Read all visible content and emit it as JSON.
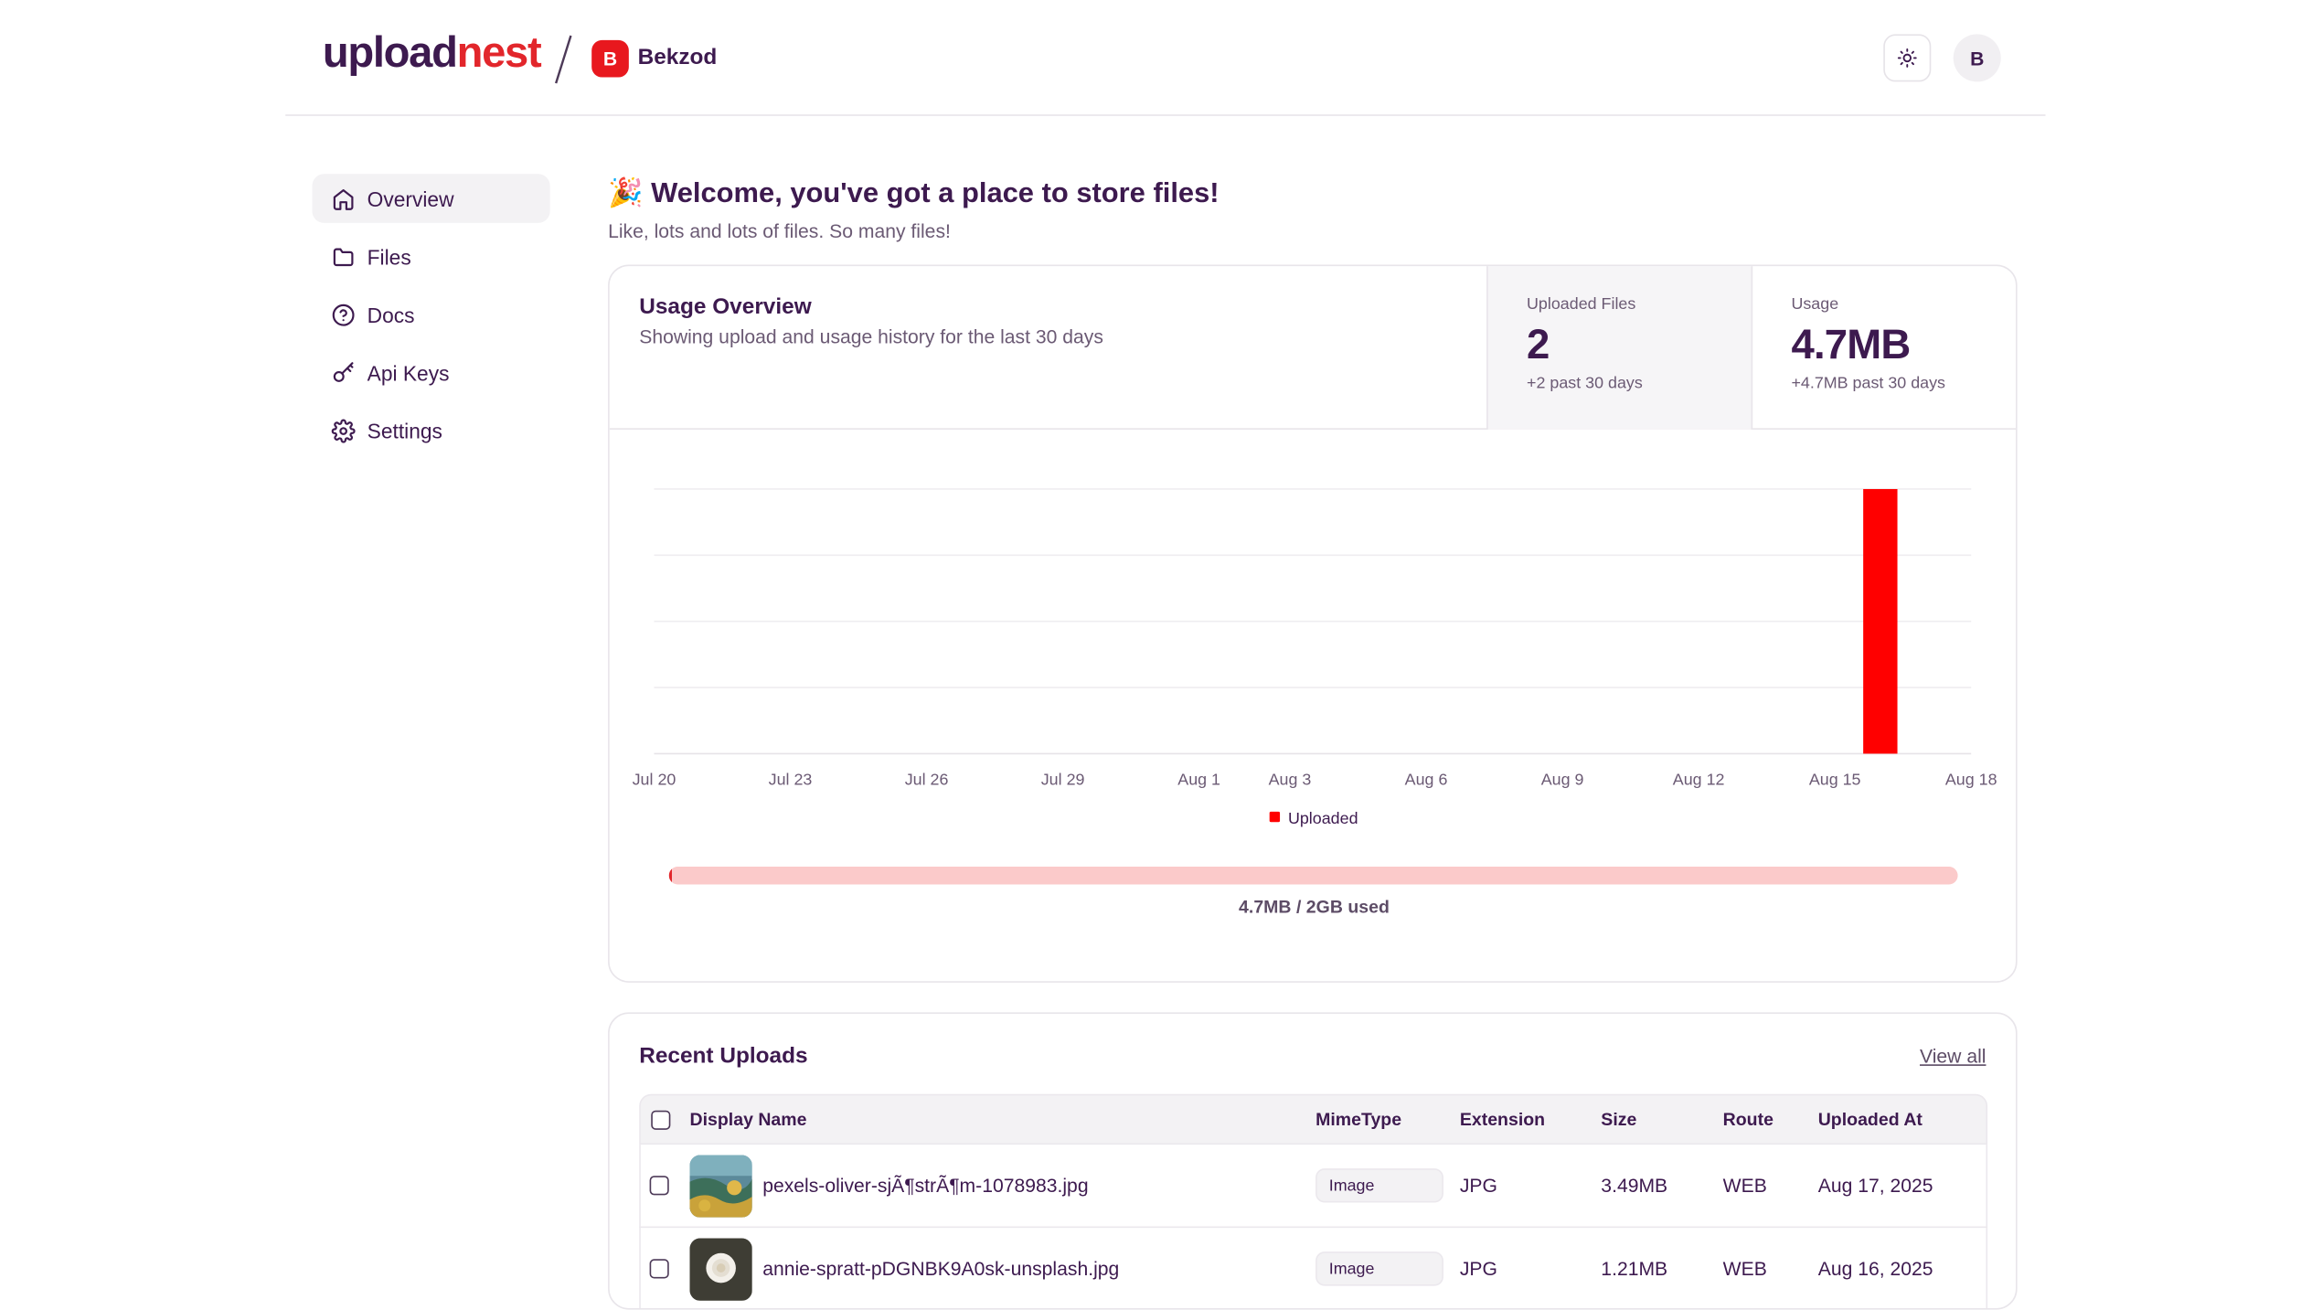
{
  "header": {
    "logo_part1": "upload",
    "logo_part2": "nest",
    "workspace_initial": "B",
    "workspace_name": "Bekzod",
    "avatar_initial": "B"
  },
  "colors": {
    "brand": "#3d1a4f",
    "accent": "#e2262b",
    "bar": "#ff0000"
  },
  "sidebar": {
    "items": [
      {
        "label": "Overview",
        "icon": "home-icon",
        "active": true
      },
      {
        "label": "Files",
        "icon": "folder-icon"
      },
      {
        "label": "Docs",
        "icon": "help-circle-icon"
      },
      {
        "label": "Api Keys",
        "icon": "key-icon"
      },
      {
        "label": "Settings",
        "icon": "gear-icon"
      }
    ]
  },
  "main": {
    "welcome": "🎉 Welcome, you've got a place to store files!",
    "subtitle": "Like, lots and lots of files. So many files!"
  },
  "usage": {
    "title": "Usage Overview",
    "description": "Showing upload and usage history for the last 30 days",
    "stats": [
      {
        "label": "Uploaded Files",
        "value": "2",
        "note": "+2 past 30 days"
      },
      {
        "label": "Usage",
        "value": "4.7MB",
        "note": "+4.7MB past 30 days"
      }
    ],
    "progress_fraction": 0.0023,
    "progress_text": "4.7MB / 2GB used"
  },
  "chart_data": {
    "type": "bar",
    "x_tick_labels": [
      "Jul 20",
      "Jul 23",
      "Jul 26",
      "Jul 29",
      "Aug 1",
      "Aug 3",
      "Aug 6",
      "Aug 9",
      "Aug 12",
      "Aug 15",
      "Aug 18"
    ],
    "x_range": [
      "Jul 20",
      "Aug 18"
    ],
    "series": [
      {
        "name": "Uploaded",
        "points": [
          {
            "x": "Aug 16",
            "y": 1
          }
        ]
      }
    ],
    "ylim": [
      0,
      1
    ],
    "grid": true,
    "legend_position": "bottom"
  },
  "recent": {
    "title": "Recent Uploads",
    "view_all": "View all",
    "columns": [
      "Display Name",
      "MimeType",
      "Extension",
      "Size",
      "Route",
      "Uploaded At"
    ],
    "rows": [
      {
        "name": "pexels-oliver-sjÃ¶strÃ¶m-1078983.jpg",
        "mime": "Image",
        "ext": "JPG",
        "size": "3.49MB",
        "route": "WEB",
        "date": "Aug 17, 2025"
      },
      {
        "name": "annie-spratt-pDGNBK9A0sk-unsplash.jpg",
        "mime": "Image",
        "ext": "JPG",
        "size": "1.21MB",
        "route": "WEB",
        "date": "Aug 16, 2025"
      }
    ]
  }
}
